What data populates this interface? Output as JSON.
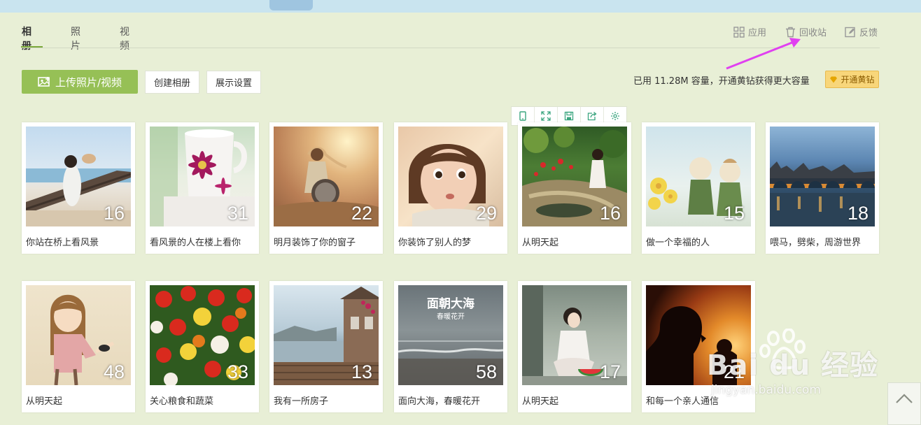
{
  "tabs": [
    {
      "label": "相册",
      "active": true
    },
    {
      "label": "照片",
      "active": false
    },
    {
      "label": "视频",
      "active": false
    }
  ],
  "toplinks": {
    "apps": {
      "label": "应用",
      "icon": "grid-icon"
    },
    "recycle": {
      "label": "回收站",
      "icon": "trash-icon"
    },
    "feedback": {
      "label": "反馈",
      "icon": "edit-icon"
    }
  },
  "actions": {
    "upload_label": "上传照片/视频",
    "create_album_label": "创建相册",
    "display_settings_label": "展示设置"
  },
  "storage": {
    "text": "已用 11.28M 容量，开通黄钻获得更大容量",
    "diamond_label": "开通黄钻"
  },
  "photo_toolbar": [
    "phone-icon",
    "fullscreen-icon",
    "save-icon",
    "share-icon",
    "settings-icon"
  ],
  "albums": [
    {
      "title": "你站在桥上看风景",
      "count": "16"
    },
    {
      "title": "看风景的人在楼上看你",
      "count": "31"
    },
    {
      "title": "明月装饰了你的窗子",
      "count": "22"
    },
    {
      "title": "你装饰了别人的梦",
      "count": "29"
    },
    {
      "title": "从明天起",
      "count": "16"
    },
    {
      "title": "做一个幸福的人",
      "count": "15"
    },
    {
      "title": "喂马，劈柴，周游世界",
      "count": "18"
    },
    {
      "title": "从明天起",
      "count": "48"
    },
    {
      "title": "关心粮食和蔬菜",
      "count": "33"
    },
    {
      "title": "我有一所房子",
      "count": "13"
    },
    {
      "title": "面向大海，春暖花开",
      "count": "58"
    },
    {
      "title": "从明天起",
      "count": "17"
    },
    {
      "title": "和每一个亲人通信",
      "count": "21"
    }
  ],
  "photo_overlay": {
    "line1": "面朝大海",
    "line2": "春暖花开"
  },
  "watermark": {
    "logo": "Bai du 经验",
    "url": "jingyan.baidu.com"
  },
  "colors": {
    "accent_green": "#96c056",
    "tab_underline": "#7aa83a",
    "diamond": "#f8d67a",
    "arrow": "#e040f0"
  }
}
